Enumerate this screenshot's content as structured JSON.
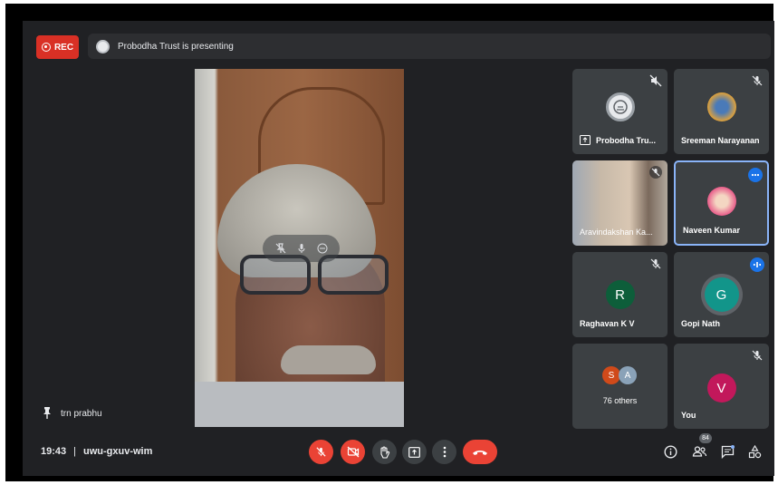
{
  "recording": {
    "label": "REC"
  },
  "presentation": {
    "banner": "Probodha Trust is presenting"
  },
  "main_video": {
    "pinned_name": "trn prabhu"
  },
  "participants": [
    {
      "name": "Probodha Tru...",
      "muted": true,
      "presenting": true
    },
    {
      "name": "Sreeman Narayanan",
      "muted": true
    },
    {
      "name": "Aravindakshan Ka...",
      "muted": true
    },
    {
      "name": "Naveen Kumar",
      "more_options": true,
      "selected": true
    },
    {
      "name": "Raghavan K V",
      "initial": "R",
      "muted": true,
      "avatar_color": "#0d5e3a"
    },
    {
      "name": "Gopi Nath",
      "initial": "G",
      "speaking": true,
      "avatar_color": "#12958a"
    },
    {
      "others_label": "76 others",
      "initials": [
        "S",
        "A"
      ],
      "colors": [
        "#d04a1a",
        "#8aa2b8"
      ]
    },
    {
      "name": "You",
      "initial": "V",
      "muted": true,
      "avatar_color": "#c2185b"
    }
  ],
  "footer": {
    "time": "19:43",
    "separator": "|",
    "meeting_code": "uwu-gxuv-wim",
    "participant_count": "84"
  },
  "colors": {
    "accent_red": "#ea4335",
    "accent_blue": "#1a73e8",
    "background": "#202124",
    "tile": "#3c4043"
  }
}
